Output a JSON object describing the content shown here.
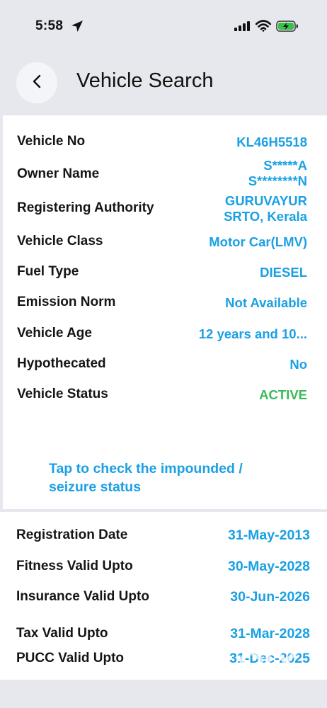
{
  "status": {
    "time": "5:58"
  },
  "header": {
    "title": "Vehicle Search"
  },
  "details": [
    {
      "label": "Vehicle No",
      "value": "KL46H5518"
    },
    {
      "label": "Owner Name",
      "value": "S*****A\nS********N"
    },
    {
      "label": "Registering Authority",
      "value": "GURUVAYUR\nSRTO, Kerala"
    },
    {
      "label": "Vehicle Class",
      "value": "Motor Car(LMV)"
    },
    {
      "label": "Fuel Type",
      "value": "DIESEL"
    },
    {
      "label": "Emission Norm",
      "value": "Not Available"
    },
    {
      "label": "Vehicle Age",
      "value": "12 years and 10..."
    },
    {
      "label": "Hypothecated",
      "value": "No"
    },
    {
      "label": "Vehicle Status",
      "value": "ACTIVE"
    }
  ],
  "impound_link": "Tap to check the impounded / seizure status",
  "validity": [
    {
      "label": "Registration Date",
      "value": "31-May-2013"
    },
    {
      "label": "Fitness Valid Upto",
      "value": "30-May-2028"
    },
    {
      "label": "Insurance Valid Upto",
      "value": "30-Jun-2026"
    },
    {
      "label": "Tax Valid Upto",
      "value": "31-Mar-2028"
    },
    {
      "label": "PUCC Valid Upto",
      "value": "31-Dec-2025"
    }
  ],
  "colors": {
    "accent": "#1aa0e4",
    "active": "#3cba5a",
    "background": "#e6e8ed"
  },
  "watermark": "OLX"
}
